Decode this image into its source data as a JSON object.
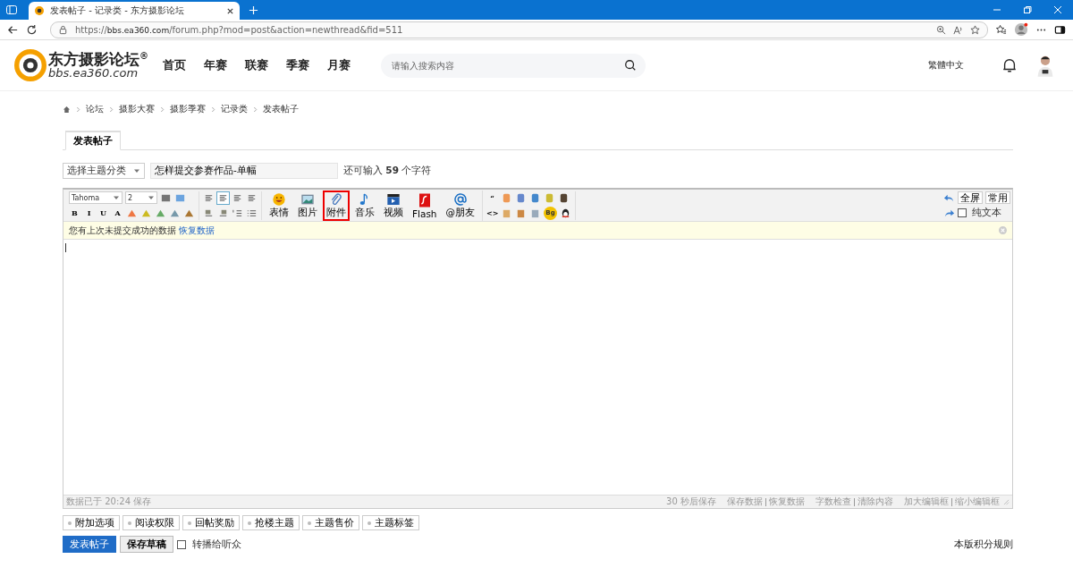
{
  "browser": {
    "tab_title": "发表帖子 - 记录类 - 东方摄影论坛",
    "url_scheme": "https://",
    "url_host": "bbs.ea360.com",
    "url_path": "/forum.php?mod=post&action=newthread&fid=511"
  },
  "site": {
    "logo_name": "东方摄影论坛",
    "logo_mark": "®",
    "logo_domain": "bbs.ea360.com",
    "nav": [
      "首页",
      "年赛",
      "联赛",
      "季赛",
      "月赛"
    ],
    "search_placeholder": "请输入搜索内容",
    "language": "繁體中文"
  },
  "breadcrumb": [
    "论坛",
    "摄影大赛",
    "摄影季赛",
    "记录类",
    "发表帖子"
  ],
  "tabs": [
    {
      "label": "发表帖子",
      "selected": true
    }
  ],
  "subject": {
    "category": "选择主题分类",
    "title": "怎样提交参赛作品-单幅",
    "remaining": "还可输入 **59** 个字符"
  },
  "editor": {
    "font": "Tahoma",
    "size": "2",
    "format_glyphs": [
      "B",
      "I",
      "U",
      "A"
    ],
    "alignments": [
      {
        "selected": false
      },
      {
        "selected": true
      },
      {
        "selected": false
      },
      {
        "selected": false
      }
    ],
    "media_buttons": [
      {
        "label": "表情",
        "highlighted": false
      },
      {
        "label": "图片",
        "highlighted": false
      },
      {
        "label": "附件",
        "highlighted": true
      },
      {
        "label": "音乐",
        "highlighted": false
      },
      {
        "label": "视频",
        "highlighted": false
      },
      {
        "label": "Flash",
        "highlighted": false
      },
      {
        "label": "@朋友",
        "highlighted": false
      }
    ],
    "code_glyphs": [
      "“",
      "<>"
    ],
    "coin_label": "Bg",
    "fullscreen": "全屏",
    "common": "常用",
    "plain_text": {
      "label": "纯文本",
      "checked": false
    },
    "notice": "您有上次未提交成功的数据",
    "notice_link": "恢复数据",
    "status_left": "数据已于 20:24 保存",
    "autosave": "30 秒后保存",
    "status_groups": [
      [
        "保存数据",
        "恢复数据"
      ],
      [
        "字数检查",
        "清除内容"
      ],
      [
        "加大编辑框",
        "缩小编辑框"
      ]
    ]
  },
  "options": [
    "附加选项",
    "阅读权限",
    "回帖奖励",
    "抢楼主题",
    "主题售价",
    "主题标签"
  ],
  "actions": {
    "submit": "发表帖子",
    "draft": "保存草稿",
    "broadcast": {
      "label": "转播给听众",
      "checked": false
    }
  },
  "rules_link": "本版积分规则"
}
